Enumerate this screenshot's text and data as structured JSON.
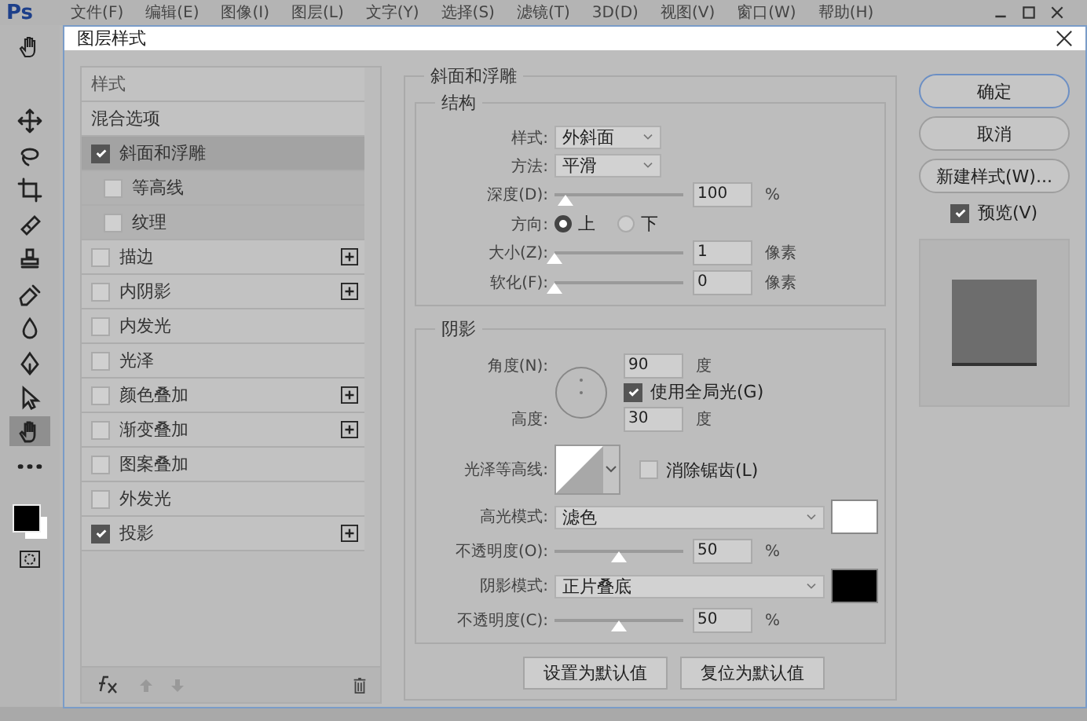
{
  "app": {
    "logo": "Ps",
    "menu": [
      "文件(F)",
      "编辑(E)",
      "图像(I)",
      "图层(L)",
      "文字(Y)",
      "选择(S)",
      "滤镜(T)",
      "3D(D)",
      "视图(V)",
      "窗口(W)",
      "帮助(H)"
    ],
    "tools": [
      {
        "kind": "move",
        "selected": false
      },
      {
        "kind": "lasso",
        "selected": false
      },
      {
        "kind": "crop",
        "selected": false
      },
      {
        "kind": "bandage",
        "selected": false
      },
      {
        "kind": "stamp",
        "selected": false
      },
      {
        "kind": "eraser",
        "selected": false
      },
      {
        "kind": "drop",
        "selected": false
      },
      {
        "kind": "pen",
        "selected": false
      },
      {
        "kind": "arrow",
        "selected": false
      },
      {
        "kind": "hand",
        "selected": true
      },
      {
        "kind": "more",
        "selected": false
      }
    ]
  },
  "dialog": {
    "title": "图层样式",
    "styles": {
      "header": "样式",
      "items": [
        {
          "label": "混合选项",
          "kind": "plain",
          "selected": false
        },
        {
          "label": "斜面和浮雕",
          "kind": "check",
          "checked": true,
          "selected": true,
          "children": [
            {
              "label": "等高线",
              "checked": false
            },
            {
              "label": "纹理",
              "checked": false
            }
          ]
        },
        {
          "label": "描边",
          "kind": "check",
          "checked": false,
          "selected": false,
          "add": true
        },
        {
          "label": "内阴影",
          "kind": "check",
          "checked": false,
          "selected": false,
          "add": true
        },
        {
          "label": "内发光",
          "kind": "check",
          "checked": false,
          "selected": false,
          "add": false
        },
        {
          "label": "光泽",
          "kind": "check",
          "checked": false,
          "selected": false,
          "add": false
        },
        {
          "label": "颜色叠加",
          "kind": "check",
          "checked": false,
          "selected": false,
          "add": true
        },
        {
          "label": "渐变叠加",
          "kind": "check",
          "checked": false,
          "selected": false,
          "add": true
        },
        {
          "label": "图案叠加",
          "kind": "check",
          "checked": false,
          "selected": false,
          "add": false
        },
        {
          "label": "外发光",
          "kind": "check",
          "checked": false,
          "selected": false,
          "add": false
        },
        {
          "label": "投影",
          "kind": "check",
          "checked": true,
          "selected": false,
          "add": true
        }
      ]
    },
    "bevel": {
      "title": "斜面和浮雕",
      "structure": {
        "title": "结构",
        "style": {
          "label": "样式:",
          "value": "外斜面"
        },
        "technique": {
          "label": "方法:",
          "value": "平滑"
        },
        "depth": {
          "label": "深度(D):",
          "level": 0.08,
          "value": "100",
          "unit": "%"
        },
        "direction": {
          "label": "方向:",
          "options": [
            {
              "label": "上",
              "selected": true
            },
            {
              "label": "下",
              "selected": false
            }
          ]
        },
        "size": {
          "label": "大小(Z):",
          "level": 0,
          "value": "1",
          "unit": "像素"
        },
        "soften": {
          "label": "软化(F):",
          "level": 0,
          "value": "0",
          "unit": "像素"
        }
      },
      "shading": {
        "title": "阴影",
        "angle": {
          "label": "角度(N):",
          "value": "90",
          "unit": "度"
        },
        "global_light": {
          "label": "使用全局光(G)",
          "checked": true
        },
        "altitude": {
          "label": "高度:",
          "value": "30",
          "unit": "度"
        },
        "gloss_contour": {
          "label": "光泽等高线:"
        },
        "anti_aliased": {
          "label": "消除锯齿(L)",
          "checked": false
        },
        "highlight_mode": {
          "label": "高光模式:",
          "value": "滤色",
          "color": "#ffffff"
        },
        "highlight_opacity": {
          "label": "不透明度(O):",
          "level": 0.5,
          "value": "50",
          "unit": "%"
        },
        "shadow_mode": {
          "label": "阴影模式:",
          "value": "正片叠底",
          "color": "#000000"
        },
        "shadow_opacity": {
          "label": "不透明度(C):",
          "level": 0.5,
          "value": "50",
          "unit": "%"
        }
      },
      "buttons": [
        "设置为默认值",
        "复位为默认值"
      ]
    },
    "actions": [
      {
        "label": "确定",
        "default": true
      },
      {
        "label": "取消",
        "default": false
      },
      {
        "label": "新建样式(W)...",
        "default": false
      }
    ],
    "preview": {
      "label": "预览(V)",
      "checked": true
    }
  }
}
